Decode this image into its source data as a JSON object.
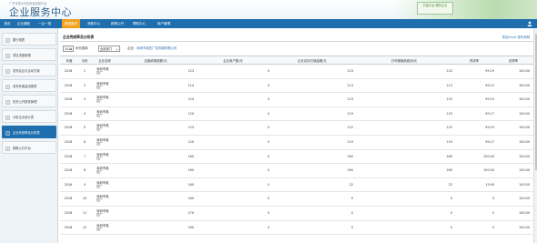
{
  "header": {
    "sub_title": "广东省惠州市投资促进局平台",
    "main_title": "企业服务中心",
    "logo_text": "共建平台 服务企业"
  },
  "nav": {
    "items": [
      {
        "label": "首页",
        "active": false
      },
      {
        "label": "企业通知",
        "active": false
      },
      {
        "label": "一企一档",
        "active": false
      },
      {
        "label": "数据服务",
        "active": true
      },
      {
        "label": "消费中心",
        "active": false
      },
      {
        "label": "政策公开",
        "active": false
      },
      {
        "label": "帮助中心",
        "active": false
      },
      {
        "label": "用户管理",
        "active": false
      }
    ]
  },
  "sidebar": {
    "items": [
      {
        "label": "履行报表",
        "active": false
      },
      {
        "label": "项目进度管理",
        "active": false
      },
      {
        "label": "发布会议与活动方案",
        "active": false
      },
      {
        "label": "发布年度监测报表",
        "active": false
      },
      {
        "label": "历史公开报表管理",
        "active": false
      },
      {
        "label": "分析企业统计表",
        "active": false
      },
      {
        "label": "企业完成率及分析表",
        "active": true
      },
      {
        "label": "报数公共平台",
        "active": false
      }
    ]
  },
  "content": {
    "title": "企业完成率及分析表",
    "export_label": "导出Excel 操作说明",
    "filter": {
      "year": "2016",
      "year_suffix": "年份选择",
      "dept": "全部部门",
      "company_prefix": "企业：",
      "company_name": "深圳市奥匹广告传媒有限公司"
    },
    "columns": [
      "年度",
      "月份",
      "企业名称",
      "应缴纳规费额/元",
      "企业用户数/元",
      "企业实际已缴金额/元",
      "已申报缴纳费用/元",
      "完成率",
      "总得率"
    ],
    "rows": [
      [
        "2016",
        "1",
        "深圳市奥匹广",
        "123",
        "0",
        "123",
        "123",
        "99.19",
        "100.00"
      ],
      [
        "2016",
        "2",
        "深圳市奥匹广",
        "114",
        "0",
        "113",
        "113",
        "99.12",
        "100.00"
      ],
      [
        "2016",
        "3",
        "深圳市奥匹广",
        "124",
        "0",
        "123",
        "123",
        "99.19",
        "100.00"
      ],
      [
        "2016",
        "4",
        "深圳市奥匹广",
        "120",
        "0",
        "119",
        "119",
        "99.17",
        "100.00"
      ],
      [
        "2016",
        "5",
        "深圳市奥匹广",
        "123",
        "0",
        "122",
        "122",
        "99.19",
        "100.00"
      ],
      [
        "2016",
        "6",
        "深圳市奥匹广",
        "120",
        "0",
        "119",
        "119",
        "99.17",
        "100.00"
      ],
      [
        "2016",
        "7",
        "深圳市奥匹广",
        "160",
        "0",
        "160",
        "160",
        "100.00",
        "100.00"
      ],
      [
        "2016",
        "8",
        "深圳市奥匹广",
        "160",
        "0",
        "160",
        "160",
        "100.00",
        "100.00"
      ],
      [
        "2016",
        "9",
        "深圳市奥匹广",
        "160",
        "0",
        "22",
        "22",
        "13.90",
        "100.00"
      ],
      [
        "2016",
        "10",
        "深圳市奥匹广",
        "160",
        "0",
        "0",
        "0",
        "0",
        "100.00"
      ],
      [
        "2016",
        "11",
        "深圳市奥匹广",
        "170",
        "0",
        "0",
        "0",
        "0",
        "100.00"
      ],
      [
        "2016",
        "12",
        "深圳市奥匹广",
        "160",
        "0",
        "0",
        "0",
        "0",
        "100.00"
      ]
    ]
  },
  "colors": {
    "nav_bg": "#1f6fae",
    "nav_active": "#f0a21e",
    "sidebar_active": "#1f6fae"
  }
}
